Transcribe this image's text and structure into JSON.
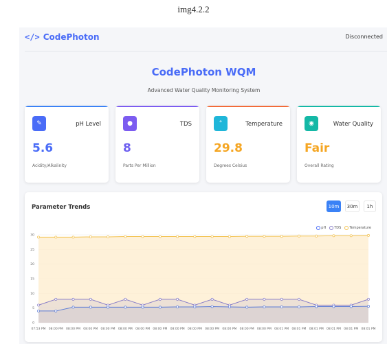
{
  "caption": "img4.2.2",
  "header": {
    "logo_icon": "</>",
    "logo_text": "CodePhoton",
    "status": "Disconnected"
  },
  "page": {
    "title": "CodePhoton WQM",
    "subtitle": "Advanced Water Quality Monitoring System"
  },
  "cards": [
    {
      "label": "pH Level",
      "value": "5.6",
      "sub": "Acidity/Alkalinity",
      "color": "#4a6cf7",
      "icon": "pencil-icon",
      "icon_glyph": "✎"
    },
    {
      "label": "TDS",
      "value": "8",
      "sub": "Parts Per Million",
      "color": "#6d5ff0",
      "icon": "water-drop-icon",
      "icon_glyph": "●"
    },
    {
      "label": "Temperature",
      "value": "29.8",
      "sub": "Degrees Celsius",
      "color": "#f5a623",
      "icon": "thermometer-icon",
      "icon_glyph": "°"
    },
    {
      "label": "Water Quality",
      "value": "Fair",
      "sub": "Overall Rating",
      "color": "#f5a623",
      "icon": "quality-icon",
      "icon_glyph": "◉"
    }
  ],
  "card_bar_colors": [
    "#3b82f6",
    "#7c5cf0",
    "#f26b3a",
    "#14b8a6"
  ],
  "card_icon_colors": [
    "#4a6cf7",
    "#7c5cf0",
    "#1fb6d9",
    "#14b8a6"
  ],
  "card_value_colors": [
    "#4a6cf7",
    "#6d5ff0",
    "#f5a623",
    "#f5a623"
  ],
  "chart": {
    "title": "Parameter Trends",
    "ranges": [
      "10m",
      "30m",
      "1h"
    ],
    "active_range": "10m",
    "legend": [
      {
        "name": "pH",
        "color": "#4a6cf7"
      },
      {
        "name": "TDS",
        "color": "#8b80c8"
      },
      {
        "name": "Temperature",
        "color": "#f2c14e"
      }
    ]
  },
  "chart_data": {
    "type": "line",
    "x": [
      "07:53 PM",
      "08:00 PM",
      "08:00 PM",
      "08:00 PM",
      "08:00 PM",
      "08:00 PM",
      "08:00 PM",
      "08:00 PM",
      "08:00 PM",
      "08:00 PM",
      "08:00 PM",
      "08:00 PM",
      "08:00 PM",
      "08:00 PM",
      "08:01 PM",
      "08:01 PM",
      "08:01 PM",
      "08:01 PM",
      "08:01 PM",
      "08:01 PM"
    ],
    "ylim": [
      0,
      30
    ],
    "yticks": [
      0,
      5,
      10,
      15,
      20,
      25,
      30
    ],
    "series": [
      {
        "name": "pH",
        "color": "#5b7bd6",
        "fill": "rgba(110,120,190,0.12)",
        "values": [
          4,
          4,
          5.3,
          5.3,
          5.3,
          5.3,
          5.3,
          5.3,
          5.4,
          5.4,
          5.5,
          5.4,
          5.3,
          5.4,
          5.4,
          5.4,
          5.5,
          5.5,
          5.5,
          5.6
        ]
      },
      {
        "name": "TDS",
        "color": "#8b80c8",
        "fill": "rgba(150,140,200,0.16)",
        "values": [
          6,
          8,
          8,
          8,
          6,
          8,
          6,
          8,
          8,
          6,
          8,
          6,
          8,
          8,
          8,
          8,
          6,
          6,
          6,
          8
        ]
      },
      {
        "name": "Temperature",
        "color": "#f2c14e",
        "fill": "rgba(253,236,204,0.75)",
        "values": [
          29.2,
          29.2,
          29.2,
          29.3,
          29.3,
          29.4,
          29.4,
          29.4,
          29.4,
          29.4,
          29.4,
          29.4,
          29.5,
          29.5,
          29.5,
          29.6,
          29.6,
          29.7,
          29.7,
          29.8
        ]
      }
    ]
  }
}
